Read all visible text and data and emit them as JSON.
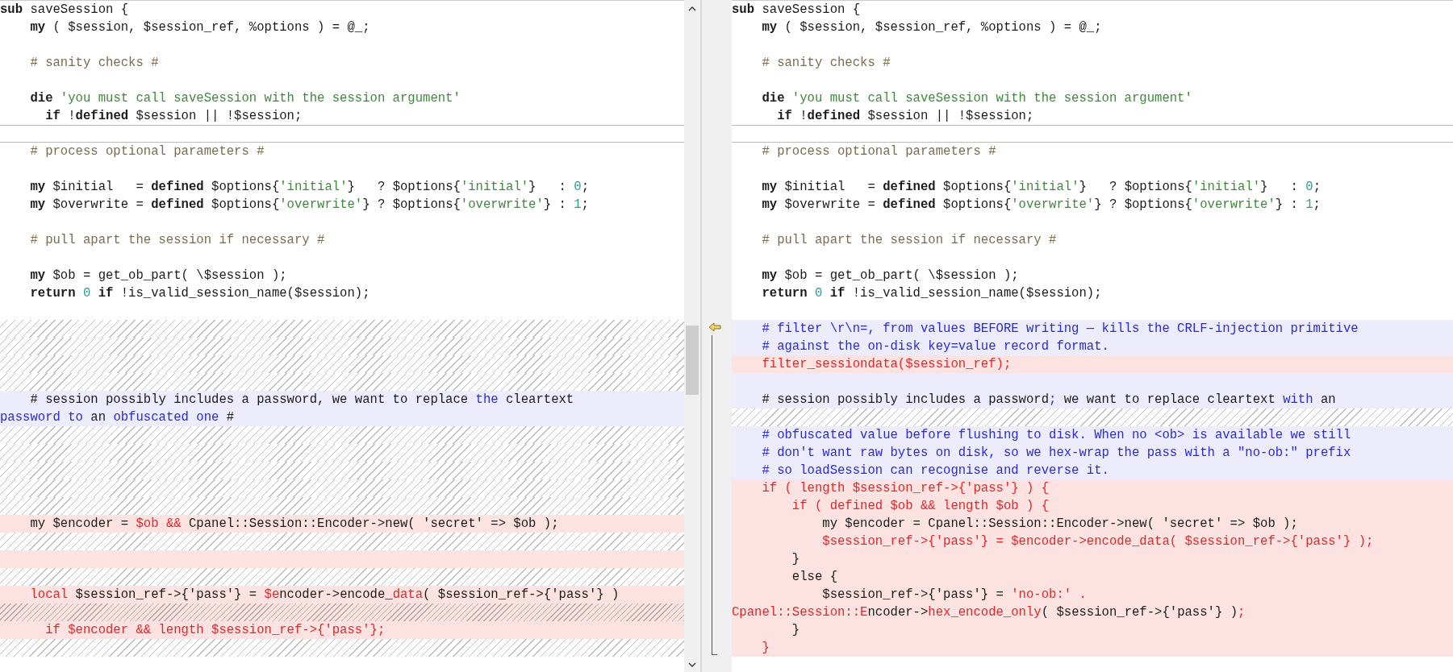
{
  "rows": [
    {
      "left": {
        "kind": "plain",
        "segs": [
          {
            "text": "sub",
            "bold": true
          },
          {
            "text": " saveSession {"
          }
        ]
      },
      "right": {
        "kind": "plain",
        "segs": [
          {
            "text": "sub",
            "bold": true
          },
          {
            "text": " saveSession {"
          }
        ]
      }
    },
    {
      "left": {
        "kind": "plain",
        "segs": [
          {
            "text": "    my",
            "bold": true
          },
          {
            "text": " ( $session, $session_ref, %options ) = @_;"
          }
        ]
      },
      "right": {
        "kind": "plain",
        "segs": [
          {
            "text": "    my",
            "bold": true
          },
          {
            "text": " ( $session, $session_ref, %options ) = @_;"
          }
        ]
      }
    },
    {
      "left": {
        "kind": "plain"
      },
      "right": {
        "kind": "plain"
      }
    },
    {
      "left": {
        "kind": "plain",
        "segs": [
          {
            "text": "    # sanity checks #",
            "color": "#7c6c4e"
          }
        ]
      },
      "right": {
        "kind": "plain",
        "segs": [
          {
            "text": "    # sanity checks #",
            "color": "#7c6c4e"
          }
        ]
      }
    },
    {
      "left": {
        "kind": "plain"
      },
      "right": {
        "kind": "plain"
      }
    },
    {
      "left": {
        "kind": "plain",
        "segs": [
          {
            "text": "    die",
            "bold": true
          },
          {
            "text": " 'you must call saveSession with the session argument'",
            "color": "#3f8a3a"
          }
        ]
      },
      "right": {
        "kind": "plain",
        "segs": [
          {
            "text": "    die",
            "bold": true
          },
          {
            "text": " 'you must call saveSession with the session argument'",
            "color": "#3f8a3a"
          }
        ]
      }
    },
    {
      "left": {
        "kind": "plain",
        "segs": [
          {
            "text": "      if",
            "bold": true
          },
          {
            "text": " !"
          },
          {
            "text": "defined",
            "bold": true
          },
          {
            "text": " $session || !$session;"
          }
        ]
      },
      "right": {
        "kind": "plain",
        "segs": [
          {
            "text": "      if",
            "bold": true
          },
          {
            "text": " !"
          },
          {
            "text": "defined",
            "bold": true
          },
          {
            "text": " $session || !$session;"
          }
        ]
      }
    },
    {
      "left": {
        "kind": "fold"
      },
      "right": {
        "kind": "fold"
      }
    },
    {
      "left": {
        "kind": "plain",
        "segs": [
          {
            "text": "    # process optional parameters #",
            "color": "#7c6c4e"
          }
        ]
      },
      "right": {
        "kind": "plain",
        "segs": [
          {
            "text": "    # process optional parameters #",
            "color": "#7c6c4e"
          }
        ]
      }
    },
    {
      "left": {
        "kind": "plain"
      },
      "right": {
        "kind": "plain"
      }
    },
    {
      "left": {
        "kind": "plain",
        "segs": [
          {
            "text": "    my",
            "bold": true
          },
          {
            "text": " $initial   = "
          },
          {
            "text": "defined",
            "bold": true
          },
          {
            "text": " $options{"
          },
          {
            "text": "'initial'",
            "color": "#3f8a3a"
          },
          {
            "text": "}   ? $options{"
          },
          {
            "text": "'initial'",
            "color": "#3f8a3a"
          },
          {
            "text": "}   : "
          },
          {
            "text": "0",
            "color": "#2a9d8f"
          },
          {
            "text": ";"
          }
        ]
      },
      "right": {
        "kind": "plain",
        "segs": [
          {
            "text": "    my",
            "bold": true
          },
          {
            "text": " $initial   = "
          },
          {
            "text": "defined",
            "bold": true
          },
          {
            "text": " $options{"
          },
          {
            "text": "'initial'",
            "color": "#3f8a3a"
          },
          {
            "text": "}   ? $options{"
          },
          {
            "text": "'initial'",
            "color": "#3f8a3a"
          },
          {
            "text": "}   : "
          },
          {
            "text": "0",
            "color": "#2a9d8f"
          },
          {
            "text": ";"
          }
        ]
      }
    },
    {
      "left": {
        "kind": "plain",
        "segs": [
          {
            "text": "    my",
            "bold": true
          },
          {
            "text": " $overwrite = "
          },
          {
            "text": "defined",
            "bold": true
          },
          {
            "text": " $options{"
          },
          {
            "text": "'overwrite'",
            "color": "#3f8a3a"
          },
          {
            "text": "} ? $options{"
          },
          {
            "text": "'overwrite'",
            "color": "#3f8a3a"
          },
          {
            "text": "} : "
          },
          {
            "text": "1",
            "color": "#2a9d8f"
          },
          {
            "text": ";"
          }
        ]
      },
      "right": {
        "kind": "plain",
        "segs": [
          {
            "text": "    my",
            "bold": true
          },
          {
            "text": " $overwrite = "
          },
          {
            "text": "defined",
            "bold": true
          },
          {
            "text": " $options{"
          },
          {
            "text": "'overwrite'",
            "color": "#3f8a3a"
          },
          {
            "text": "} ? $options{"
          },
          {
            "text": "'overwrite'",
            "color": "#3f8a3a"
          },
          {
            "text": "} : "
          },
          {
            "text": "1",
            "color": "#2a9d8f"
          },
          {
            "text": ";"
          }
        ]
      }
    },
    {
      "left": {
        "kind": "plain"
      },
      "right": {
        "kind": "plain"
      }
    },
    {
      "left": {
        "kind": "plain",
        "segs": [
          {
            "text": "    # pull apart the session if necessary #",
            "color": "#7c6c4e"
          }
        ]
      },
      "right": {
        "kind": "plain",
        "segs": [
          {
            "text": "    # pull apart the session if necessary #",
            "color": "#7c6c4e"
          }
        ]
      }
    },
    {
      "left": {
        "kind": "plain"
      },
      "right": {
        "kind": "plain"
      }
    },
    {
      "left": {
        "kind": "plain",
        "segs": [
          {
            "text": "    my",
            "bold": true
          },
          {
            "text": " $ob = get_ob_part( \\$session );"
          }
        ]
      },
      "right": {
        "kind": "plain",
        "segs": [
          {
            "text": "    my",
            "bold": true
          },
          {
            "text": " $ob = get_ob_part( \\$session );"
          }
        ]
      }
    },
    {
      "left": {
        "kind": "plain",
        "segs": [
          {
            "text": "    return",
            "bold": true
          },
          {
            "text": " 0",
            "color": "#2a9d8f"
          },
          {
            "text": " if",
            "bold": true
          },
          {
            "text": " !is_valid_session_name($session);"
          }
        ]
      },
      "right": {
        "kind": "plain",
        "segs": [
          {
            "text": "    return",
            "bold": true
          },
          {
            "text": " 0",
            "color": "#2a9d8f"
          },
          {
            "text": " if",
            "bold": true
          },
          {
            "text": " !is_valid_session_name($session);"
          }
        ]
      }
    },
    {
      "left": {
        "kind": "plain"
      },
      "right": {
        "kind": "plain"
      }
    },
    {
      "left": {
        "kind": "gap"
      },
      "right": {
        "kind": "changed",
        "segs": [
          {
            "text": "    # filter \\r\\n=, from values BEFORE writing — kills the CRLF-injection primitive",
            "color": "#2a2ad8"
          }
        ]
      }
    },
    {
      "left": {
        "kind": "gap"
      },
      "right": {
        "kind": "changed",
        "segs": [
          {
            "text": "    # against the on-disk key=value record format.",
            "color": "#2a2ad8"
          }
        ]
      }
    },
    {
      "left": {
        "kind": "gap"
      },
      "right": {
        "kind": "removed",
        "segs": [
          {
            "text": "    filter_sessiondata($session_ref);",
            "color": "#e02828"
          }
        ]
      }
    },
    {
      "left": {
        "kind": "gap"
      },
      "right": {
        "kind": "changed"
      }
    },
    {
      "left": {
        "kind": "changed",
        "segs": [
          {
            "text": "    # session possibly includes a password, we want to replace "
          },
          {
            "text": "the",
            "color": "#2a2ad8"
          },
          {
            "text": " cleartext"
          }
        ]
      },
      "right": {
        "kind": "changed",
        "segs": [
          {
            "text": "    # session possibly includes a password"
          },
          {
            "text": ";",
            "color": "#2a2ad8"
          },
          {
            "text": " we want to replace cleartext "
          },
          {
            "text": "with",
            "color": "#2a2ad8"
          },
          {
            "text": " an"
          }
        ]
      }
    },
    {
      "left": {
        "kind": "changed",
        "segs": [
          {
            "text": "password to",
            "color": "#2a2ad8"
          },
          {
            "text": " an "
          },
          {
            "text": "obfuscated one",
            "color": "#2a2ad8"
          },
          {
            "text": " #"
          }
        ]
      },
      "right": {
        "kind": "gap"
      }
    },
    {
      "left": {
        "kind": "gap"
      },
      "right": {
        "kind": "changed",
        "segs": [
          {
            "text": "    # obfuscated value before flushing to disk. When no <ob> is available we still",
            "color": "#2a2ad8"
          }
        ]
      }
    },
    {
      "left": {
        "kind": "gap"
      },
      "right": {
        "kind": "changed",
        "segs": [
          {
            "text": "    # don't want raw bytes on disk, so we hex-wrap the pass with a \"no-ob:\" prefix",
            "color": "#2a2ad8"
          }
        ]
      }
    },
    {
      "left": {
        "kind": "gap"
      },
      "right": {
        "kind": "changed",
        "segs": [
          {
            "text": "    # so loadSession can recognise and reverse it.",
            "color": "#2a2ad8"
          }
        ]
      }
    },
    {
      "left": {
        "kind": "gap"
      },
      "right": {
        "kind": "removed",
        "segs": [
          {
            "text": "    if ( length $session_ref->{'pass'} ) {",
            "color": "#e02828"
          }
        ]
      }
    },
    {
      "left": {
        "kind": "gap"
      },
      "right": {
        "kind": "removed",
        "segs": [
          {
            "text": "        if ( defined $ob && length $ob ) {",
            "color": "#e02828"
          }
        ]
      }
    },
    {
      "left": {
        "kind": "removed",
        "segs": [
          {
            "text": "    my $encoder = "
          },
          {
            "text": "$ob &&",
            "color": "#e02828"
          },
          {
            "text": " Cpanel::Session::Encoder->new( 'secret' => $ob );"
          }
        ]
      },
      "right": {
        "kind": "removed",
        "segs": [
          {
            "text": "            my $encoder = Cpanel::Session::Encoder->new( 'secret' => $ob );"
          }
        ]
      }
    },
    {
      "left": {
        "kind": "gap"
      },
      "right": {
        "kind": "removed",
        "segs": [
          {
            "text": "            $session_ref->{'pass'} = $encoder->encode_data( $session_ref->{'pass'} );",
            "color": "#e02828"
          }
        ]
      }
    },
    {
      "left": {
        "kind": "removed"
      },
      "right": {
        "kind": "removed",
        "segs": [
          {
            "text": "        }"
          }
        ]
      }
    },
    {
      "left": {
        "kind": "gap"
      },
      "right": {
        "kind": "removed",
        "segs": [
          {
            "text": "        else {"
          }
        ]
      }
    },
    {
      "left": {
        "kind": "removed",
        "segs": [
          {
            "text": "    local",
            "color": "#e02828"
          },
          {
            "text": " $session_ref->{'pass'} = "
          },
          {
            "text": "$e",
            "color": "#e02828"
          },
          {
            "text": "ncoder->encode_"
          },
          {
            "text": "data",
            "color": "#e02828"
          },
          {
            "text": "( $session_ref->{'pass'} )"
          }
        ]
      },
      "right": {
        "kind": "removed",
        "segs": [
          {
            "text": "            $session_ref->{'pass'} = "
          },
          {
            "text": "'no-ob:' .",
            "color": "#e02828"
          }
        ]
      }
    },
    {
      "left": {
        "kind": "gap-removed"
      },
      "right": {
        "kind": "removed",
        "segs": [
          {
            "text": "Cpanel::Session::E",
            "color": "#e02828"
          },
          {
            "text": "ncoder->"
          },
          {
            "text": "hex_encode_only",
            "color": "#e02828"
          },
          {
            "text": "( $session_ref->{'pass'} )"
          },
          {
            "text": ";",
            "color": "#e02828"
          }
        ]
      }
    },
    {
      "left": {
        "kind": "removed",
        "segs": [
          {
            "text": "      if $encoder && length $session_ref->{'pass'};",
            "color": "#e02828"
          }
        ]
      },
      "right": {
        "kind": "removed",
        "segs": [
          {
            "text": "        }"
          }
        ]
      }
    },
    {
      "left": {
        "kind": "gap"
      },
      "right": {
        "kind": "removed",
        "segs": [
          {
            "text": "    }",
            "color": "#e02828"
          }
        ]
      }
    }
  ]
}
